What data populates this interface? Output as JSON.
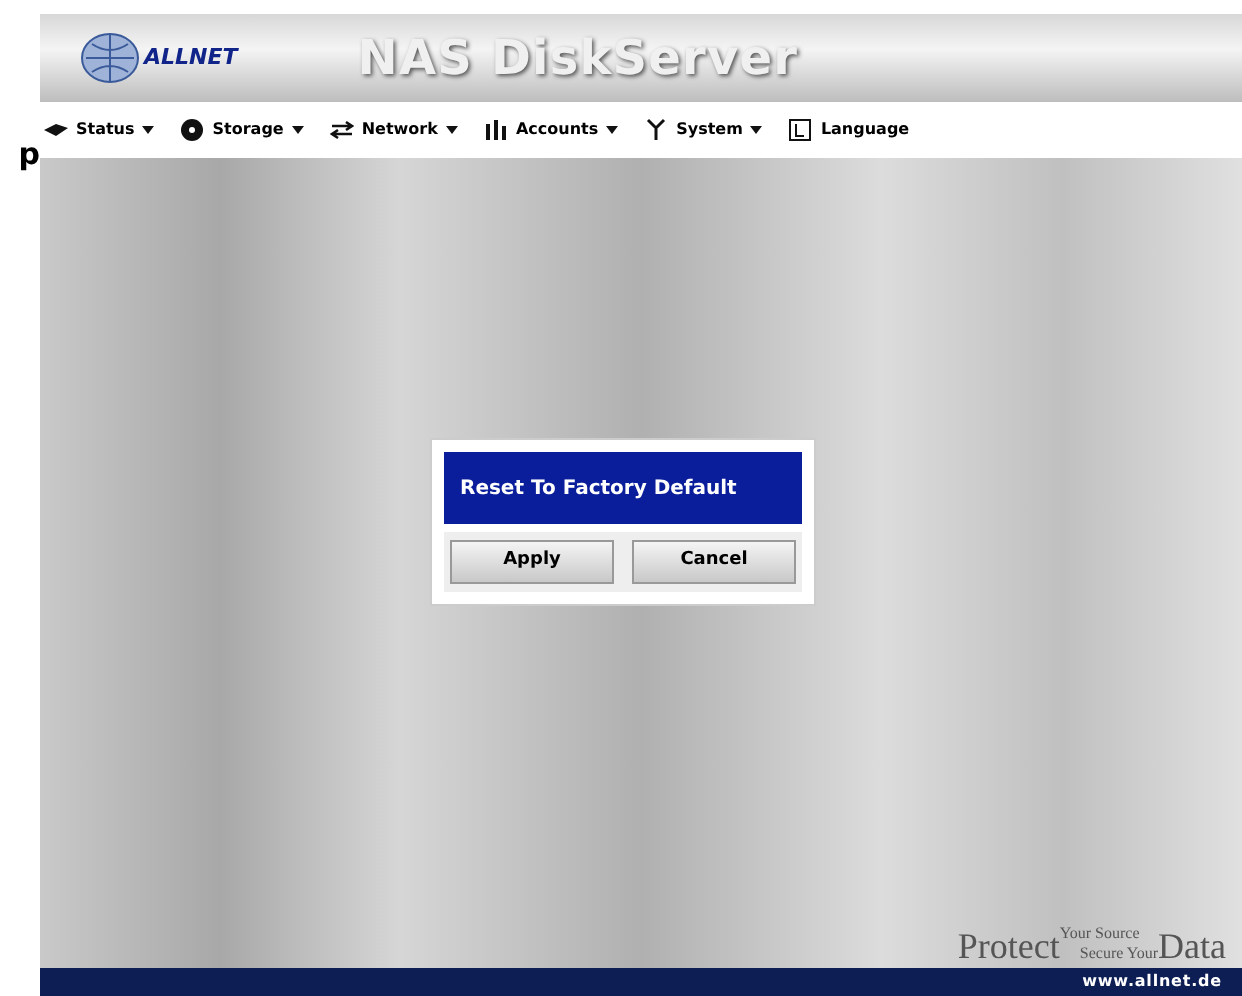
{
  "side_text": "p",
  "header": {
    "brand": "ALLNET",
    "title": "NAS DiskServer"
  },
  "menu": [
    {
      "label": "Status",
      "kind": "disk",
      "dropdown": true
    },
    {
      "label": "Storage",
      "kind": "disc",
      "dropdown": true
    },
    {
      "label": "Network",
      "kind": "arrows",
      "dropdown": true
    },
    {
      "label": "Accounts",
      "kind": "bars",
      "dropdown": true
    },
    {
      "label": "System",
      "kind": "wrench",
      "dropdown": true
    },
    {
      "label": "Language",
      "kind": "letter",
      "dropdown": false
    }
  ],
  "dialog": {
    "title": "Reset To Factory Default",
    "buttons": [
      "Apply",
      "Cancel"
    ]
  },
  "tagline": {
    "big_1": "Protect",
    "small_1": "Your Source",
    "small_2": "Secure Your",
    "big_2": "Data"
  },
  "footer": {
    "url": "www.allnet.de"
  }
}
